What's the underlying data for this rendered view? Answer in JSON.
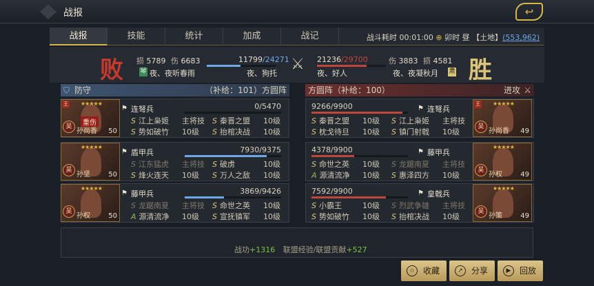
{
  "header": {
    "title": "战报"
  },
  "tabs": [
    "战报",
    "技能",
    "统计",
    "加成",
    "战记"
  ],
  "battle_info": {
    "time_label": "战斗耗时",
    "time": "00:01:00",
    "slot": "卯时",
    "day": "昼",
    "land": "【土地】",
    "coord": "(553,962)"
  },
  "summary": {
    "lose_label": "败",
    "win_label": "胜",
    "left": {
      "loss_label": "损",
      "loss": "5789",
      "hurt_label": "伤",
      "hurt": "6683",
      "hp": "11799",
      "hp_max": "/24271",
      "hp_fraction": 0.49,
      "camp_icon": "琴",
      "player": "夜、夜听春雨",
      "ally": "夜、狗托"
    },
    "right": {
      "hp": "21236",
      "hp_max": "/29700",
      "hp_fraction": 0.72,
      "hurt_label": "伤",
      "hurt": "3883",
      "loss_label": "损",
      "loss": "4581",
      "ally": "夜、好人",
      "player": "夜、夜凝秋月",
      "camp_icon": "肃"
    }
  },
  "left_side": {
    "label": "防守",
    "supply": "（补给：101）方圆阵"
  },
  "right_side": {
    "label": "方圆阵（补给：100）",
    "action": "进攻"
  },
  "left_units": [
    {
      "troop": "连弩兵",
      "hp": "0/5470",
      "hp_fraction": 0.0,
      "portrait": {
        "name": "孙尚香",
        "level": "50",
        "stars": "★★★★★",
        "wounded": "重伤",
        "camp": "吴",
        "wang": "王"
      },
      "skills": [
        {
          "grade": "S",
          "name": "江上枭姬",
          "note": "主将技",
          "dim": false
        },
        {
          "grade": "S",
          "name": "秦晋之盟",
          "note": "10级",
          "dim": false
        },
        {
          "grade": "S",
          "name": "势如破竹",
          "note": "10级",
          "dim": false
        },
        {
          "grade": "S",
          "name": "抬棺决战",
          "note": "10级",
          "dim": false
        }
      ]
    },
    {
      "troop": "盾甲兵",
      "hp": "7930/9375",
      "hp_fraction": 0.85,
      "portrait": {
        "name": "孙坚",
        "level": "50",
        "stars": "★★★★★",
        "wounded": "",
        "camp": "吴",
        "wang": ""
      },
      "skills": [
        {
          "grade": "S",
          "name": "江东猛虎",
          "note": "主将技",
          "dim": true
        },
        {
          "grade": "S",
          "name": "破虏",
          "note": "10级",
          "dim": false
        },
        {
          "grade": "S",
          "name": "烽火连天",
          "note": "10级",
          "dim": false
        },
        {
          "grade": "S",
          "name": "万人之敌",
          "note": "10级",
          "dim": false
        }
      ]
    },
    {
      "troop": "藤甲兵",
      "hp": "3869/9426",
      "hp_fraction": 0.41,
      "portrait": {
        "name": "孙权",
        "level": "50",
        "stars": "★★★★★",
        "wounded": "",
        "camp": "吴",
        "wang": ""
      },
      "skills": [
        {
          "grade": "S",
          "name": "龙踞南夏",
          "note": "主将技",
          "dim": true
        },
        {
          "grade": "S",
          "name": "命世之英",
          "note": "10级",
          "dim": false
        },
        {
          "grade": "A",
          "name": "源清流净",
          "note": "10级",
          "dim": false
        },
        {
          "grade": "S",
          "name": "宣抚镇军",
          "note": "10级",
          "dim": false
        }
      ]
    }
  ],
  "right_units": [
    {
      "troop": "连弩兵",
      "hp": "9266/9900",
      "hp_fraction": 0.94,
      "portrait": {
        "name": "孙尚香",
        "level": "49",
        "stars": "★★★★★",
        "wounded": "",
        "camp": "吴",
        "wang": "王"
      },
      "skills": [
        {
          "grade": "S",
          "name": "秦晋之盟",
          "note": "10级",
          "dim": false
        },
        {
          "grade": "S",
          "name": "江上枭姬",
          "note": "主将技",
          "dim": false
        },
        {
          "grade": "S",
          "name": "枕戈待旦",
          "note": "10级",
          "dim": false
        },
        {
          "grade": "S",
          "name": "镇门射戟",
          "note": "10级",
          "dim": false
        }
      ]
    },
    {
      "troop": "藤甲兵",
      "hp": "4378/9900",
      "hp_fraction": 0.44,
      "portrait": {
        "name": "孙权",
        "level": "49",
        "stars": "★★★★★",
        "wounded": "",
        "camp": "吴",
        "wang": ""
      },
      "skills": [
        {
          "grade": "S",
          "name": "命世之英",
          "note": "10级",
          "dim": false
        },
        {
          "grade": "S",
          "name": "龙踞南夏",
          "note": "主将技",
          "dim": true
        },
        {
          "grade": "A",
          "name": "源清流净",
          "note": "10级",
          "dim": false
        },
        {
          "grade": "S",
          "name": "惠泽四方",
          "note": "10级",
          "dim": false
        }
      ]
    },
    {
      "troop": "皇戟兵",
      "hp": "7592/9900",
      "hp_fraction": 0.77,
      "portrait": {
        "name": "孙策",
        "level": "49",
        "stars": "★★★★★",
        "wounded": "",
        "camp": "吴",
        "wang": ""
      },
      "skills": [
        {
          "grade": "S",
          "name": "小霸王",
          "note": "10级",
          "dim": false
        },
        {
          "grade": "S",
          "name": "烈武争雄",
          "note": "主将技",
          "dim": true
        },
        {
          "grade": "S",
          "name": "势如破竹",
          "note": "10级",
          "dim": false
        },
        {
          "grade": "S",
          "name": "抬棺决战",
          "note": "10级",
          "dim": false
        }
      ]
    }
  ],
  "footer": {
    "merit_label": "战功",
    "merit": "+1316",
    "exp_label": "联盟经验/联盟贡献",
    "exp": "+527"
  },
  "buttons": [
    {
      "label": "收藏",
      "icon": "star-icon"
    },
    {
      "label": "分享",
      "icon": "share-icon"
    },
    {
      "label": "回放",
      "icon": "play-icon"
    }
  ],
  "colors": {
    "gold": "#d9b84a",
    "lose": "#c73a2a",
    "hp_blue": "#6fa8e8",
    "hp_red": "#c0453a",
    "plus": "#7fc34a"
  }
}
